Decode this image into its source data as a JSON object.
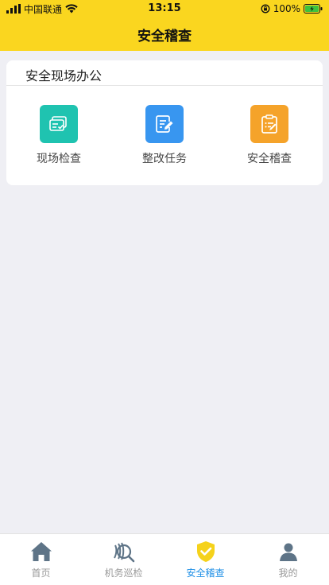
{
  "status_bar": {
    "carrier": "中国联通",
    "time": "13:15",
    "battery": "100%"
  },
  "nav": {
    "title": "安全稽查"
  },
  "section": {
    "title": "安全现场办公",
    "items": [
      {
        "label": "现场检查",
        "icon": "cards-check-icon",
        "color": "#1fc3b0"
      },
      {
        "label": "整改任务",
        "icon": "edit-document-icon",
        "color": "#3896f0"
      },
      {
        "label": "安全稽查",
        "icon": "clipboard-icon",
        "color": "#f5a32a"
      }
    ]
  },
  "tabbar": {
    "active_color": "#1e8fe6",
    "tabs": [
      {
        "label": "首页",
        "icon": "home-icon"
      },
      {
        "label": "机务巡检",
        "icon": "inspection-icon"
      },
      {
        "label": "安全稽查",
        "icon": "shield-check-icon"
      },
      {
        "label": "我的",
        "icon": "user-icon"
      }
    ]
  }
}
